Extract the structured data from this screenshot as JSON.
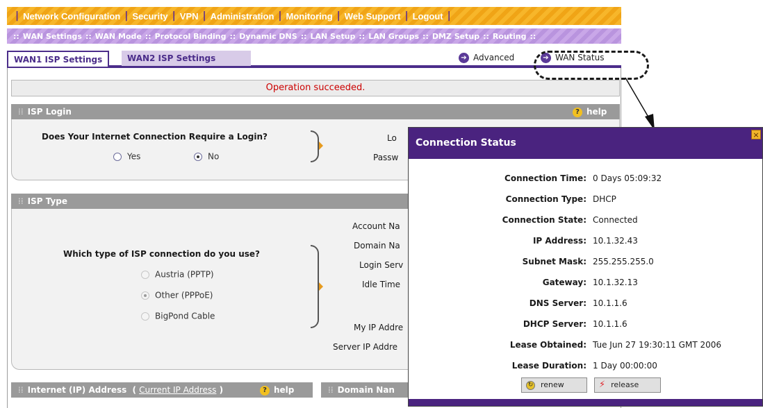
{
  "top_nav": [
    "Network Configuration",
    "Security",
    "VPN",
    "Administration",
    "Monitoring",
    "Web Support",
    "Logout"
  ],
  "sub_nav": [
    "WAN Settings",
    "WAN Mode",
    "Protocol Binding",
    "Dynamic DNS",
    "LAN Setup",
    "LAN Groups",
    "DMZ Setup",
    "Routing"
  ],
  "tabs": {
    "wan1": "WAN1 ISP Settings",
    "wan2": "WAN2 ISP Settings",
    "advanced": "Advanced",
    "wan_status": "WAN Status"
  },
  "operation_message": "Operation succeeded.",
  "isp_login": {
    "title": "ISP Login",
    "help": "help",
    "question": "Does Your Internet Connection Require a Login?",
    "options": [
      "Yes",
      "No"
    ],
    "selected": "No",
    "fields": [
      "Lo",
      "Passw"
    ]
  },
  "isp_type": {
    "title": "ISP Type",
    "question": "Which type of ISP connection do you use?",
    "options": [
      "Austria (PPTP)",
      "Other (PPPoE)",
      "BigPond Cable"
    ],
    "selected": "Other (PPPoE)",
    "fields": [
      "Account Na",
      "Domain Na",
      "Login Serv",
      "Idle Time",
      "My IP Addre",
      "Server IP Addre"
    ]
  },
  "internet_ip": {
    "title": "Internet (IP) Address",
    "link_open": "(",
    "link": "Current IP Address",
    "link_close": ")",
    "help": "help"
  },
  "domain_section": {
    "title": "Domain Nan"
  },
  "connection_status": {
    "title": "Connection Status",
    "close": "×",
    "rows": [
      {
        "label": "Connection Time:",
        "value": "0 Days 05:09:32"
      },
      {
        "label": "Connection Type:",
        "value": "DHCP"
      },
      {
        "label": "Connection State:",
        "value": "Connected"
      },
      {
        "label": "IP Address:",
        "value": "10.1.32.43"
      },
      {
        "label": "Subnet Mask:",
        "value": "255.255.255.0"
      },
      {
        "label": "Gateway:",
        "value": "10.1.32.13"
      },
      {
        "label": "DNS Server:",
        "value": "10.1.1.6"
      },
      {
        "label": "DHCP Server:",
        "value": "10.1.1.6"
      },
      {
        "label": "Lease Obtained:",
        "value": "Tue Jun 27 19:30:11 GMT 2006"
      },
      {
        "label": "Lease Duration:",
        "value": "1 Day 00:00:00"
      }
    ],
    "renew": "renew",
    "release": "release"
  },
  "icons": {
    "section_grip": "grip-icon",
    "help": "help-icon",
    "arrow": "circle-arrow-icon",
    "renew": "renew-icon",
    "release": "release-icon"
  },
  "colors": {
    "nav_orange": "#f0a416",
    "subnav_purple": "#b994de",
    "popup_header": "#4a237f",
    "error_red": "#cc0000"
  }
}
